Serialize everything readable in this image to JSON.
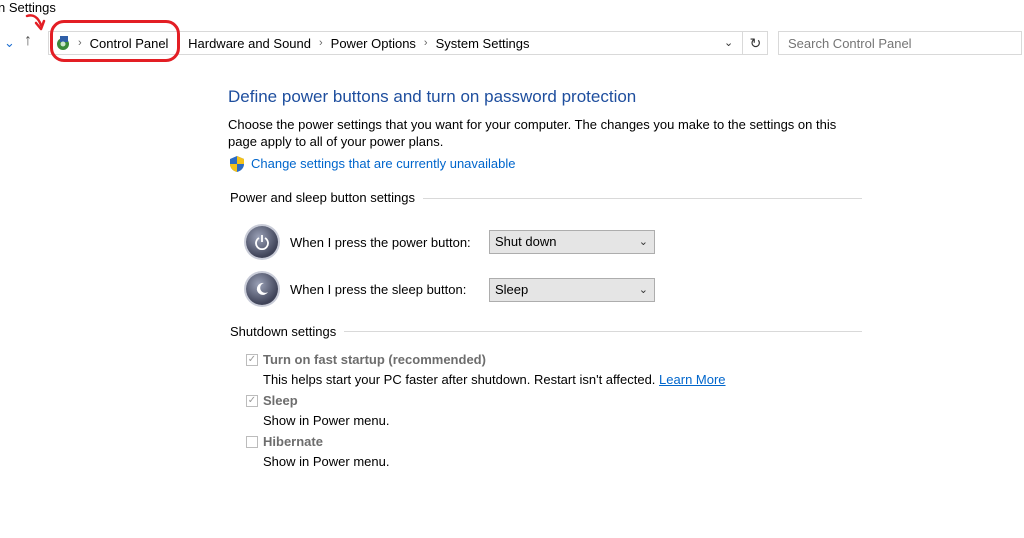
{
  "window": {
    "title_fragment": "n Settings"
  },
  "nav": {
    "back_icon": "back-arrow-icon",
    "up_icon": "up-arrow-icon"
  },
  "breadcrumb": {
    "items": [
      "Control Panel",
      "Hardware and Sound",
      "Power Options",
      "System Settings"
    ],
    "separator": "›"
  },
  "search": {
    "placeholder": "Search Control Panel"
  },
  "page": {
    "title": "Define power buttons and turn on password protection",
    "description": "Choose the power settings that you want for your computer. The changes you make to the settings on this page apply to all of your power plans.",
    "change_link": "Change settings that are currently unavailable"
  },
  "power_sleep": {
    "group_label": "Power and sleep button settings",
    "power_button": {
      "label": "When I press the power button:",
      "value": "Shut down"
    },
    "sleep_button": {
      "label": "When I press the sleep button:",
      "value": "Sleep"
    }
  },
  "shutdown": {
    "group_label": "Shutdown settings",
    "fast_startup": {
      "label": "Turn on fast startup (recommended)",
      "checked": true,
      "desc": "This helps start your PC faster after shutdown. Restart isn't affected.",
      "link": "Learn More"
    },
    "sleep": {
      "label": "Sleep",
      "checked": true,
      "desc": "Show in Power menu."
    },
    "hibernate": {
      "label": "Hibernate",
      "checked": false,
      "desc": "Show in Power menu."
    }
  },
  "colors": {
    "annotation_red": "#e31e24",
    "title_blue": "#1e4e9e",
    "link_blue": "#0066cc"
  }
}
